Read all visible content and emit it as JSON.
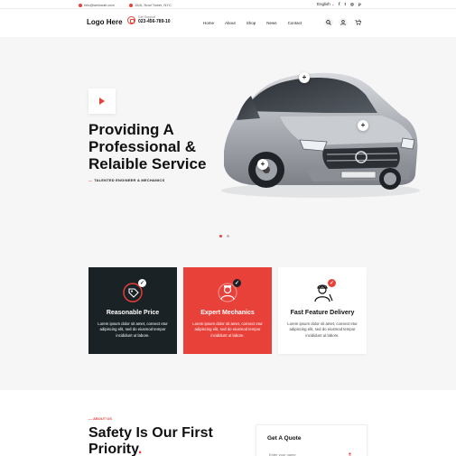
{
  "topbar": {
    "email": "info@webmail.com",
    "address": "15/A, Nost Tower, NYC",
    "language": "English",
    "language_caret": "⌄",
    "socials": [
      "f",
      "t",
      "◎",
      "p"
    ],
    "social_names": [
      "facebook-icon",
      "twitter-icon",
      "instagram-icon",
      "pinterest-icon"
    ]
  },
  "header": {
    "logo": "Logo Here",
    "support_label": "Get Support",
    "support_phone": "023-456-789-10",
    "nav": [
      "Home",
      "About",
      "Shop",
      "News",
      "Contact"
    ],
    "cart_count": "0"
  },
  "hero": {
    "title_lines": [
      "Providing A",
      "Professional &",
      "Relaible Service"
    ],
    "subtitle": "TALENTED ENGINEER & MECHANICS",
    "hotspots": [
      "+",
      "+",
      "+"
    ],
    "slides": 2,
    "active_slide": 1
  },
  "features": [
    {
      "title": "Reasonable Price",
      "text": "Lorem ipsum dolor sit amet, consect etur adipiscing elit, sed do eiusmod tempor incididunt ut labore.",
      "icon": "price-tag-icon",
      "check": "✓"
    },
    {
      "title": "Expert Mechanics",
      "text": "Lorem ipsum dolor sit amet, consect etur adipiscing elit, sed do eiusmod tempor incididunt ut labore.",
      "icon": "mechanic-icon",
      "check": "✓"
    },
    {
      "title": "Fast Feature Delivery",
      "text": "Lorem ipsum dolor sit amet, consect etur adipiscing elit, sed do eiusmod tempor incididunt ut labore.",
      "icon": "delivery-worker-icon",
      "check": "✓"
    }
  ],
  "about": {
    "label": "ABOUT US",
    "title": "Safety Is Our First Priority",
    "title_dot": "."
  },
  "quote": {
    "title": "Get A Quote",
    "name_placeholder": "Enter your name"
  },
  "colors": {
    "accent": "#e8413a",
    "dark_card": "#1a2226",
    "background": "#f6f6f7"
  }
}
